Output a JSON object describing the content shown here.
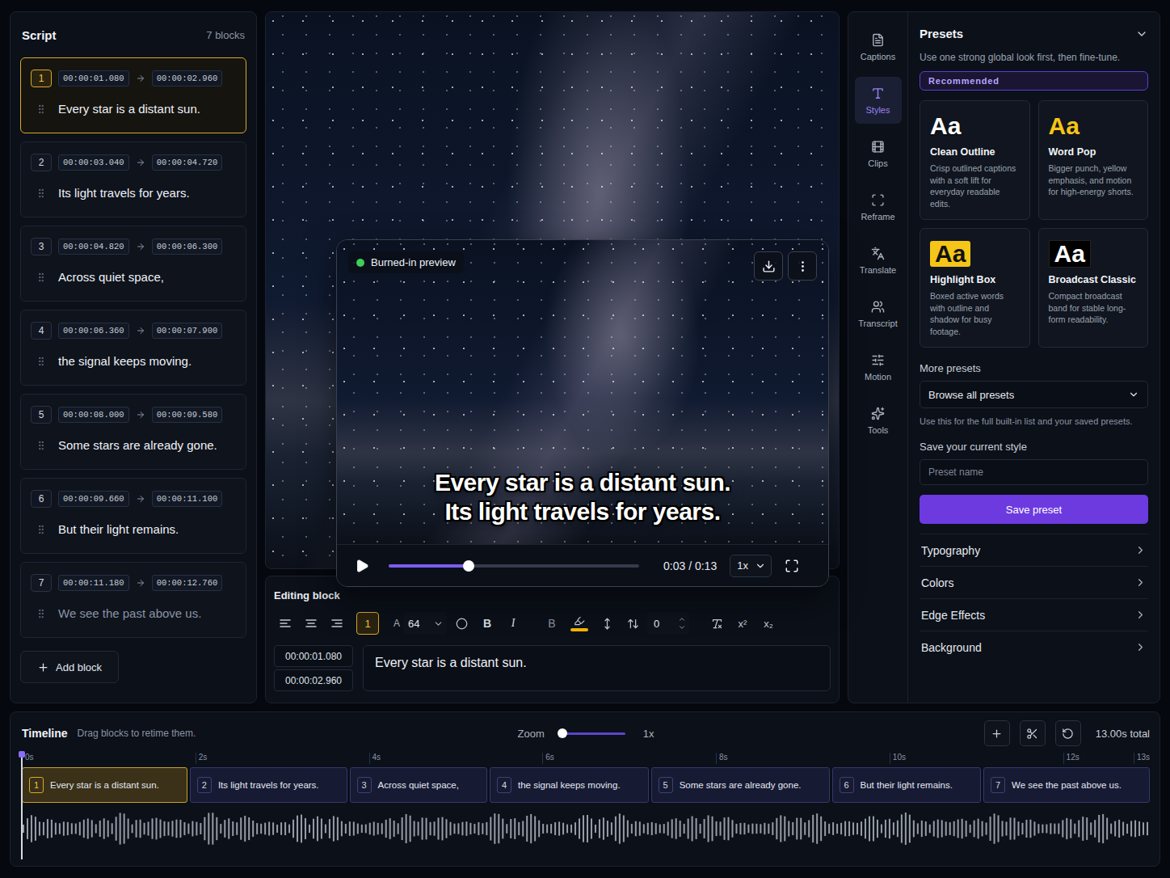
{
  "script": {
    "title": "Script",
    "count": "7 blocks",
    "add_label": "Add block",
    "blocks": [
      {
        "number": "1",
        "start": "00:00:01.080",
        "end": "00:00:02.960",
        "text": "Every star is a distant sun.",
        "selected": true,
        "dimmed": false
      },
      {
        "number": "2",
        "start": "00:00:03.040",
        "end": "00:00:04.720",
        "text": "Its light travels for years.",
        "selected": false,
        "dimmed": false
      },
      {
        "number": "3",
        "start": "00:00:04.820",
        "end": "00:00:06.300",
        "text": "Across quiet space,",
        "selected": false,
        "dimmed": false
      },
      {
        "number": "4",
        "start": "00:00:06.360",
        "end": "00:00:07.900",
        "text": "the signal keeps moving.",
        "selected": false,
        "dimmed": false
      },
      {
        "number": "5",
        "start": "00:00:08.000",
        "end": "00:00:09.580",
        "text": "Some stars are already gone.",
        "selected": false,
        "dimmed": false
      },
      {
        "number": "6",
        "start": "00:00:09.660",
        "end": "00:00:11.100",
        "text": "But their light remains.",
        "selected": false,
        "dimmed": false
      },
      {
        "number": "7",
        "start": "00:00:11.180",
        "end": "00:00:12.760",
        "text": "We see the past above us.",
        "selected": false,
        "dimmed": true
      }
    ]
  },
  "preview": {
    "badge": "Burned-in preview",
    "caption_lines": [
      "Every star is a distant sun.",
      "Its light travels for years."
    ],
    "playing": false,
    "level": 0.32,
    "time": "0:03 / 0:13",
    "speed": "1x"
  },
  "editor": {
    "title": "Editing block",
    "block_number": {
      "label": "1",
      "selected": true
    },
    "font_label": "A",
    "font_size": "64",
    "format_buttons": [
      {
        "label": "B",
        "kind": "bold",
        "selected": false
      },
      {
        "label": "I",
        "kind": "italic",
        "selected": false
      },
      {
        "label": "B",
        "kind": "outline",
        "selected": false
      }
    ],
    "spacing": "0",
    "script_buttons": [
      "x²",
      "x₂"
    ],
    "start": "00:00:01.080",
    "end": "00:00:02.960",
    "text": "Every star is a distant sun."
  },
  "rail": {
    "items": [
      {
        "label": "Captions",
        "selected": false
      },
      {
        "label": "Styles",
        "selected": true
      },
      {
        "label": "Clips",
        "selected": false
      },
      {
        "label": "Reframe",
        "selected": false
      },
      {
        "label": "Translate",
        "selected": false
      },
      {
        "label": "Transcript",
        "selected": false
      },
      {
        "label": "Motion",
        "selected": false
      },
      {
        "label": "Tools",
        "selected": false
      }
    ]
  },
  "presets": {
    "title": "Presets",
    "expanded": true,
    "subtitle": "Use one strong global look first, then fine-tune.",
    "group_label": "Recommended",
    "cards": [
      {
        "sample": "Aa",
        "name": "Clean Outline",
        "description": "Crisp outlined captions with a soft lift for everyday readable edits.",
        "kind": "outline"
      },
      {
        "sample": "Aa",
        "name": "Word Pop",
        "description": "Bigger punch, yellow emphasis, and motion for high-energy shorts.",
        "kind": "pop"
      },
      {
        "sample": "Aa",
        "name": "Highlight Box",
        "description": "Boxed active words with outline and shadow for busy footage.",
        "kind": "box"
      },
      {
        "sample": "Aa",
        "name": "Broadcast Classic",
        "description": "Compact broadcast band for stable long-form readability.",
        "kind": "band"
      }
    ],
    "more_label": "More presets",
    "browse": "Browse all presets",
    "browse_hint": "Use this for the full built-in list and your saved presets.",
    "save_label": "Save your current style",
    "name_placeholder": "Preset name",
    "save_button": "Save preset",
    "sections": [
      {
        "label": "Typography",
        "expanded": false
      },
      {
        "label": "Colors",
        "expanded": false
      },
      {
        "label": "Edge Effects",
        "expanded": false
      },
      {
        "label": "Background",
        "expanded": false
      }
    ]
  },
  "timeline": {
    "title": "Timeline",
    "hint": "Drag blocks to retime them.",
    "zoom_label": "Zoom",
    "zoom_level": 0,
    "zoom_value": "1x",
    "total": "13.00s total",
    "ticks": [
      "0s",
      "2s",
      "4s",
      "6s",
      "8s",
      "10s",
      "12s",
      "13s"
    ],
    "playhead_level": 0
  }
}
